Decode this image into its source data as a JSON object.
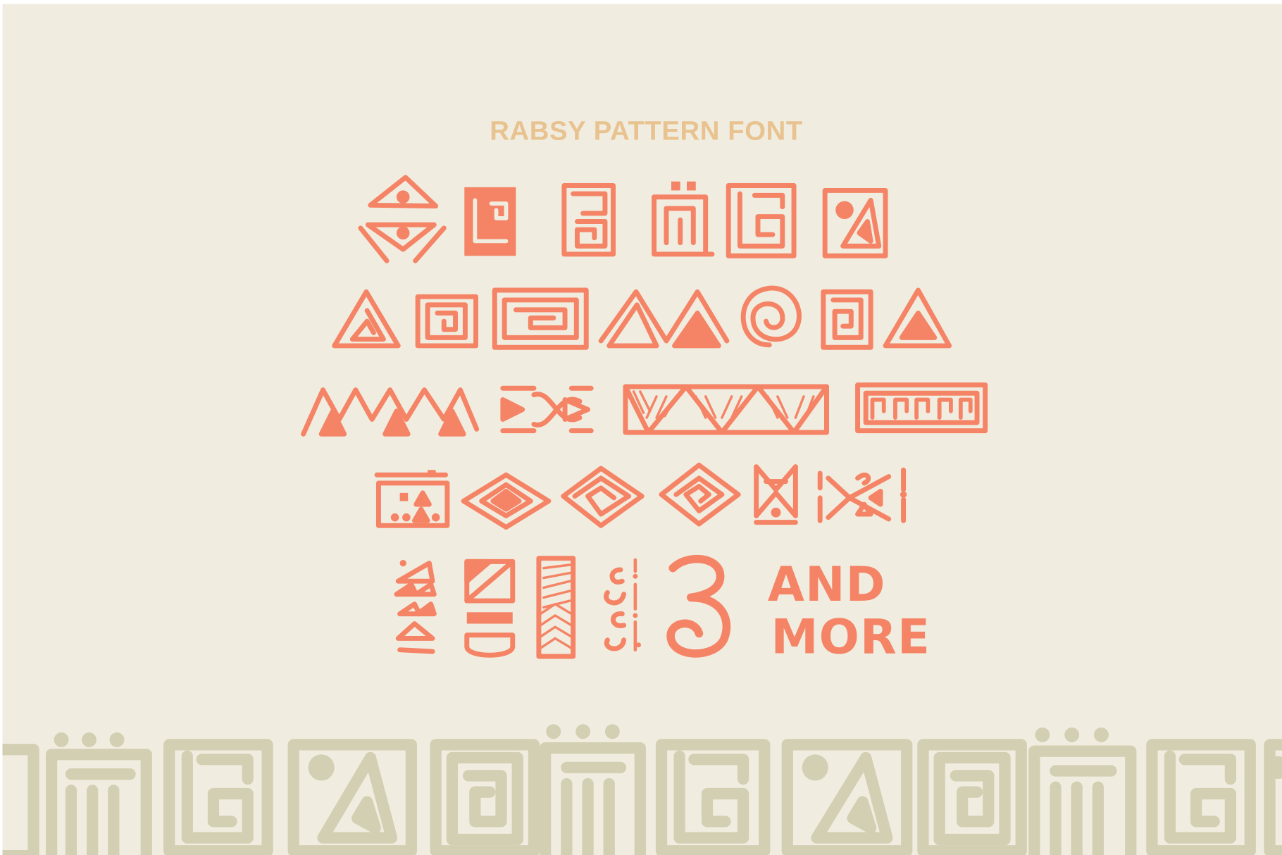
{
  "title": "RABSY PATTERN FONT",
  "tagline": {
    "line1": "AND",
    "line2": "MORE"
  },
  "colors": {
    "background": "#f0ede0",
    "title": "#e8c28f",
    "glyph": "#f58466",
    "border_pattern": "#d2cfb2"
  },
  "rows": [
    [
      "diamond-dots-icon",
      "spiral-block-solid-icon",
      "maze-box-icon",
      "dotted-gate-icon",
      "spiral-square-icon",
      "dot-triangle-box-icon"
    ],
    [
      "spiral-triangle-icon",
      "square-spiral-icon",
      "wide-spiral-icon",
      "double-mountain-icon",
      "round-spiral-icon",
      "spiral-box-icon",
      "nested-triangle-icon"
    ],
    [
      "zigzag-icon",
      "arrow-knot-icon",
      "hatched-triangles-icon",
      "meander-band-icon"
    ],
    [
      "dotted-frame-icon",
      "nested-diamond-icon",
      "spiral-diamond-icon",
      "square-spiral-diamond-icon",
      "hourglass-icon",
      "spiral-arrow-icon"
    ],
    [
      "stacked-triangles-icon",
      "split-block-icon",
      "hatched-column-icon",
      "spiral-column-icon",
      "numeral-three-icon"
    ]
  ]
}
